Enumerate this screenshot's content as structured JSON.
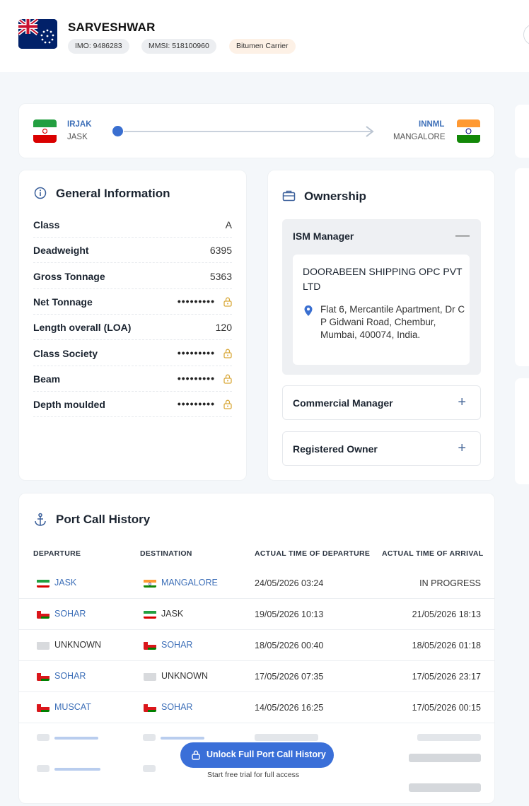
{
  "vessel": {
    "name": "SARVESHWAR",
    "imo": "IMO: 9486283",
    "mmsi": "MMSI: 518100960",
    "type": "Bitumen Carrier",
    "flag_icon": "cook-islands-flag-icon"
  },
  "route": {
    "origin": {
      "code": "IRJAK",
      "name": "JASK",
      "flag_icon": "iran-flag-icon"
    },
    "destination": {
      "code": "INNML",
      "name": "MANGALORE",
      "flag_icon": "india-flag-icon"
    }
  },
  "general_info": {
    "title": "General Information",
    "rows": [
      {
        "label": "Class",
        "value": "A",
        "locked": false
      },
      {
        "label": "Deadweight",
        "value": "6395",
        "locked": false
      },
      {
        "label": "Gross Tonnage",
        "value": "5363",
        "locked": false
      },
      {
        "label": "Net Tonnage",
        "value": "•••••••••",
        "locked": true
      },
      {
        "label": "Length overall (LOA)",
        "value": "120",
        "locked": false
      },
      {
        "label": "Class Society",
        "value": "•••••••••",
        "locked": true
      },
      {
        "label": "Beam",
        "value": "•••••••••",
        "locked": true
      },
      {
        "label": "Depth moulded",
        "value": "•••••••••",
        "locked": true
      }
    ]
  },
  "ownership": {
    "title": "Ownership",
    "ism_manager": {
      "label": "ISM Manager",
      "company": "DOORABEEN SHIPPING OPC PVT LTD",
      "address": "Flat 6, Mercantile Apartment, Dr C P Gidwani Road, Chembur, Mumbai, 400074, India."
    },
    "commercial_manager": {
      "label": "Commercial Manager"
    },
    "registered_owner": {
      "label": "Registered Owner"
    }
  },
  "port_calls": {
    "title": "Port Call History",
    "headers": [
      "DEPARTURE",
      "DESTINATION",
      "ACTUAL TIME OF DEPARTURE",
      "ACTUAL TIME OF ARRIVAL"
    ],
    "rows": [
      {
        "dep": "JASK",
        "dep_flag": "iran",
        "dep_link": true,
        "dest": "MANGALORE",
        "dest_flag": "india",
        "dest_link": true,
        "atd": "24/05/2026 03:24",
        "ata": "IN PROGRESS"
      },
      {
        "dep": "SOHAR",
        "dep_flag": "oman",
        "dep_link": true,
        "dest": "JASK",
        "dest_flag": "iran",
        "dest_link": false,
        "atd": "19/05/2026 10:13",
        "ata": "21/05/2026 18:13"
      },
      {
        "dep": "UNKNOWN",
        "dep_flag": "unknown",
        "dep_link": false,
        "dest": "SOHAR",
        "dest_flag": "oman",
        "dest_link": true,
        "atd": "18/05/2026 00:40",
        "ata": "18/05/2026 01:18"
      },
      {
        "dep": "SOHAR",
        "dep_flag": "oman",
        "dep_link": true,
        "dest": "UNKNOWN",
        "dest_flag": "unknown",
        "dest_link": false,
        "atd": "17/05/2026 07:35",
        "ata": "17/05/2026 23:17"
      },
      {
        "dep": "MUSCAT",
        "dep_flag": "oman",
        "dep_link": true,
        "dest": "SOHAR",
        "dest_flag": "oman",
        "dest_link": true,
        "atd": "14/05/2026 16:25",
        "ata": "17/05/2026 00:15"
      }
    ],
    "unlock_label": "Unlock Full Port Call History",
    "unlock_note": "Start free trial for full access"
  },
  "colors": {
    "accent": "#3a6fd8",
    "link": "#3d6fb8",
    "type_pill": "#fdf1e6",
    "lock": "#d9a93b"
  }
}
